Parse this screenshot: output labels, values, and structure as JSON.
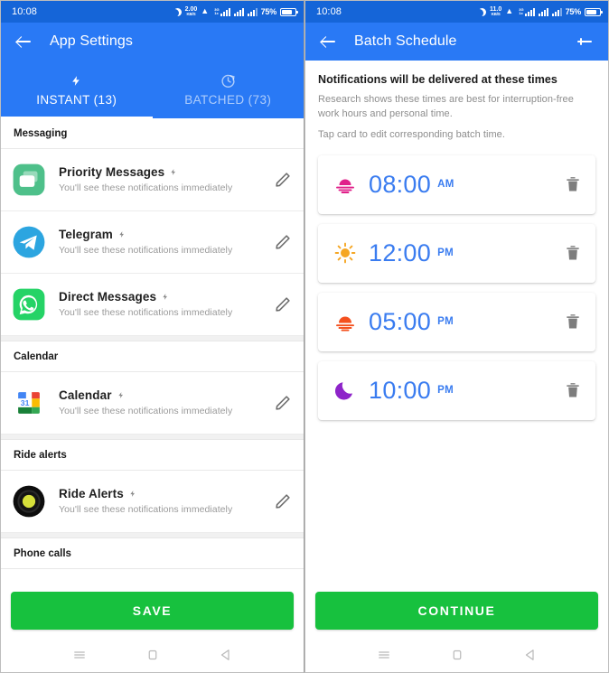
{
  "status_bar": {
    "time": "10:08",
    "icons": [
      "moon-icon",
      "network-speed-icon",
      "wifi-icon",
      "sim-signal-icon",
      "signal-bars-icon",
      "signal-bars-secondary-icon"
    ],
    "left_net_speed_value": "2.00",
    "left_net_speed_unit": "KB/S",
    "right_net_speed_value": "11.0",
    "right_net_speed_unit": "KB/S",
    "sim_label_top": "3G",
    "sim_label_bottom": "1x",
    "battery_percent": "75%"
  },
  "left_screen": {
    "appbar": {
      "title": "App Settings",
      "back_icon": "arrow-back-icon"
    },
    "tabs": [
      {
        "label": "INSTANT (13)",
        "icon": "lightning-bolt-icon",
        "active": true
      },
      {
        "label": "BATCHED (73)",
        "icon": "clock-refresh-icon",
        "active": false
      }
    ],
    "sections": [
      {
        "header": "Messaging",
        "items": [
          {
            "title": "Priority Messages",
            "subtitle": "You'll see these notifications immediately",
            "icon": "messages-app-icon",
            "badge_icon": "lightning-bolt-icon",
            "edit_icon": "pencil-icon"
          },
          {
            "title": "Telegram",
            "subtitle": "You'll see these notifications immediately",
            "icon": "telegram-app-icon",
            "badge_icon": "lightning-bolt-icon",
            "edit_icon": "pencil-icon"
          },
          {
            "title": "Direct Messages",
            "subtitle": "You'll see these notifications immediately",
            "icon": "whatsapp-app-icon",
            "badge_icon": "lightning-bolt-icon",
            "edit_icon": "pencil-icon"
          }
        ]
      },
      {
        "header": "Calendar",
        "items": [
          {
            "title": "Calendar",
            "subtitle": "You'll see these notifications immediately",
            "icon": "google-calendar-app-icon",
            "icon_day": "31",
            "badge_icon": "lightning-bolt-icon",
            "edit_icon": "pencil-icon"
          }
        ]
      },
      {
        "header": "Ride alerts",
        "items": [
          {
            "title": "Ride Alerts",
            "subtitle": "You'll see these notifications immediately",
            "icon": "ride-alerts-app-icon",
            "badge_icon": "lightning-bolt-icon",
            "edit_icon": "pencil-icon"
          }
        ]
      },
      {
        "header": "Phone calls",
        "items": []
      }
    ],
    "cta_label": "SAVE"
  },
  "right_screen": {
    "appbar": {
      "title": "Batch Schedule",
      "back_icon": "arrow-back-icon",
      "add_icon": "plus-icon"
    },
    "heading": "Notifications will be delivered at these times",
    "paragraph": "Research shows these times are best for interruption-free work hours and personal time.",
    "hint": "Tap card to edit corresponding batch time.",
    "schedule": [
      {
        "time": "08:00",
        "meridiem": "AM",
        "icon": "sunrise-icon",
        "icon_color": "#e0218a",
        "delete_icon": "trash-icon"
      },
      {
        "time": "12:00",
        "meridiem": "PM",
        "icon": "sun-icon",
        "icon_color": "#f5a623",
        "delete_icon": "trash-icon"
      },
      {
        "time": "05:00",
        "meridiem": "PM",
        "icon": "sunset-icon",
        "icon_color": "#f4501e",
        "delete_icon": "trash-icon"
      },
      {
        "time": "10:00",
        "meridiem": "PM",
        "icon": "moon-icon",
        "icon_color": "#8e24c9",
        "delete_icon": "trash-icon"
      }
    ],
    "cta_label": "CONTINUE"
  },
  "nav_bar": {
    "items": [
      {
        "icon": "recents-menu-icon"
      },
      {
        "icon": "home-square-icon"
      },
      {
        "icon": "back-triangle-icon"
      }
    ]
  },
  "colors": {
    "status_bar": "#1565d8",
    "app_bar": "#2979f5",
    "cta_green": "#17c13e",
    "time_blue": "#3a7cf0"
  }
}
